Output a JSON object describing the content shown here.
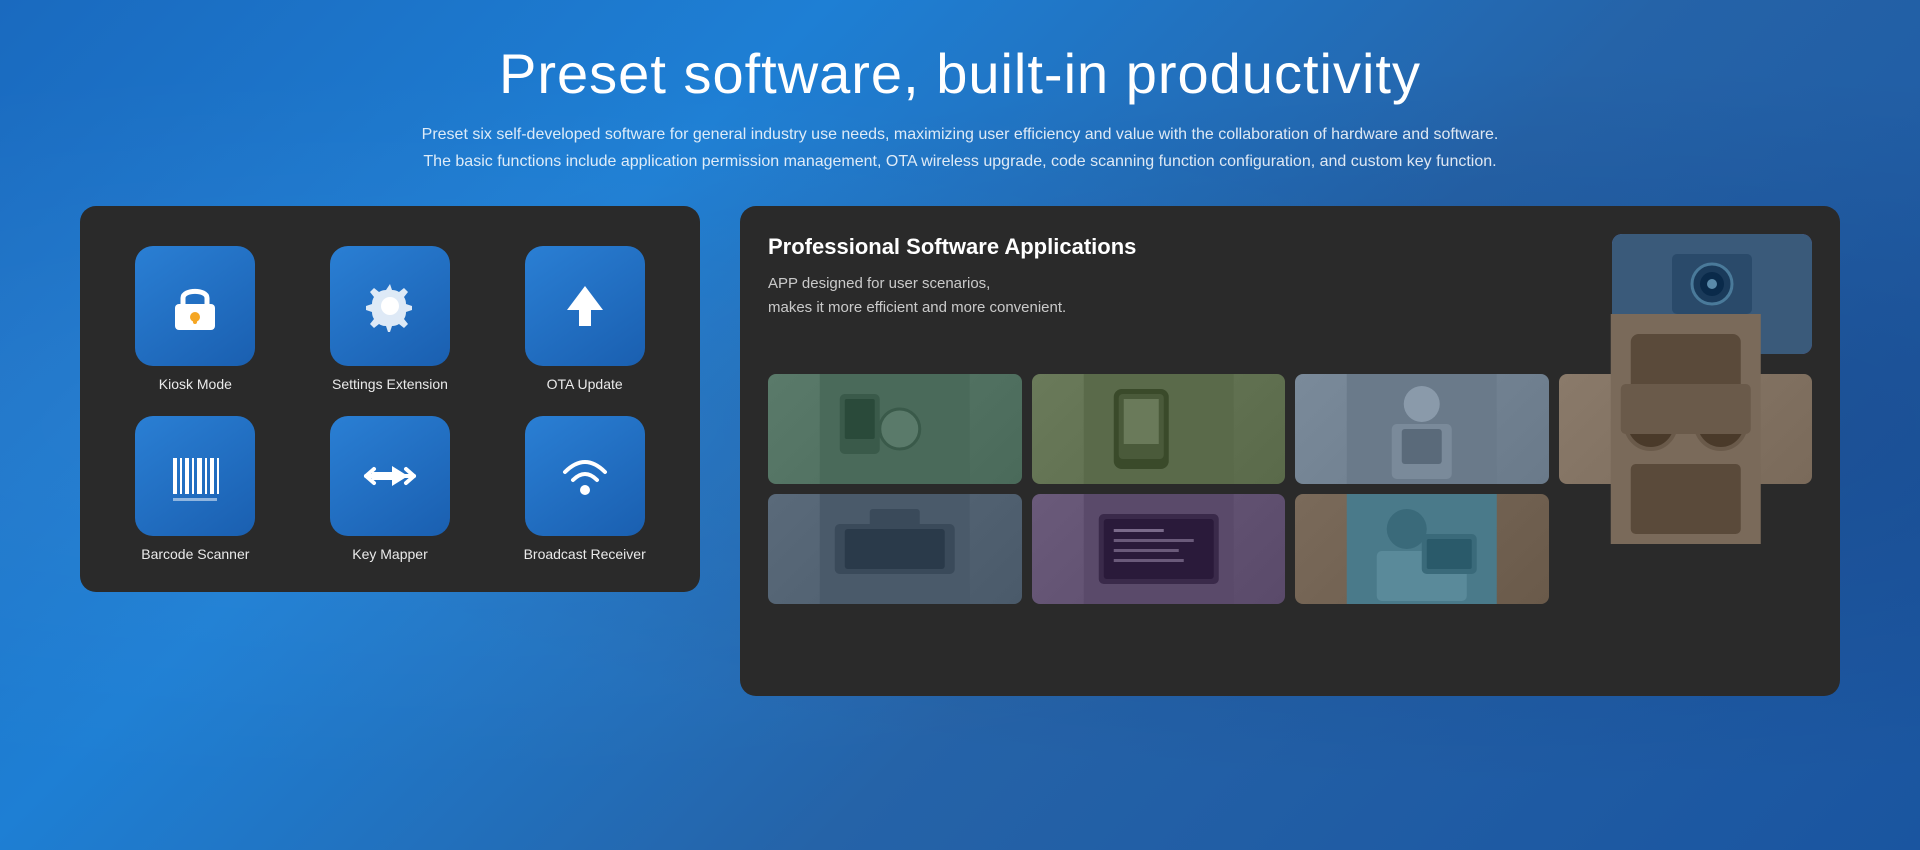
{
  "page": {
    "title": "Preset software, built-in productivity",
    "subtitle_line1": "Preset six self-developed software for general industry use needs, maximizing user efficiency and value with the collaboration of hardware and software.",
    "subtitle_line2": "The basic functions include application permission management, OTA wireless upgrade, code scanning function configuration, and custom key function."
  },
  "left_panel": {
    "apps": [
      {
        "id": "kiosk",
        "label": "Kiosk Mode",
        "icon": "lock"
      },
      {
        "id": "settings",
        "label": "Settings Extension",
        "icon": "gear"
      },
      {
        "id": "ota",
        "label": "OTA Update",
        "icon": "upload"
      },
      {
        "id": "barcode",
        "label": "Barcode Scanner",
        "icon": "barcode"
      },
      {
        "id": "keymapper",
        "label": "Key Mapper",
        "icon": "arrows"
      },
      {
        "id": "broadcast",
        "label": "Broadcast Receiver",
        "icon": "signal"
      }
    ]
  },
  "right_panel": {
    "title": "Professional Software Applications",
    "description_line1": "APP designed for user scenarios,",
    "description_line2": "makes it more efficient and more convenient.",
    "photos": [
      {
        "id": "p1",
        "alt": "Industrial device"
      },
      {
        "id": "p2",
        "alt": "Tablet in use"
      },
      {
        "id": "p3",
        "alt": "Worker with device"
      },
      {
        "id": "p4",
        "alt": "Vehicle mount"
      },
      {
        "id": "p5",
        "alt": "Printing device"
      },
      {
        "id": "p6",
        "alt": "Screen display"
      },
      {
        "id": "p7",
        "alt": "Person with tablet"
      },
      {
        "id": "p8",
        "alt": "Industrial use"
      }
    ]
  }
}
